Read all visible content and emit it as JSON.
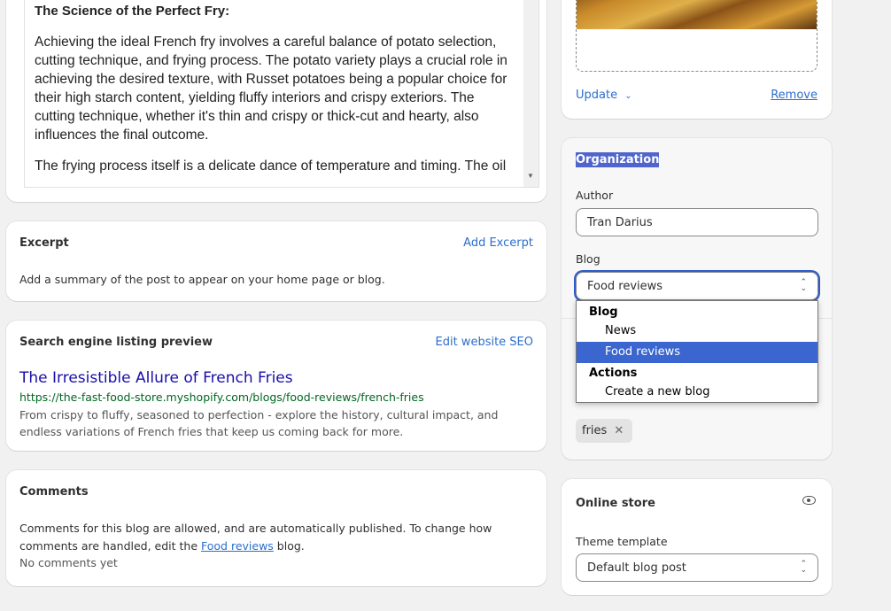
{
  "editor": {
    "heading": "The Science of the Perfect Fry:",
    "paragraphs": [
      "Achieving the ideal French fry involves a careful balance of potato selection, cutting technique, and frying process. The potato variety plays a crucial role in achieving the desired texture, with Russet potatoes being a popular choice for their high starch content, yielding fluffy interiors and crispy exteriors. The cutting technique, whether it's thin and crispy or thick-cut and hearty, also influences the final outcome.",
      "The frying process itself is a delicate dance of temperature and timing. The oil"
    ]
  },
  "excerpt": {
    "title": "Excerpt",
    "action": "Add Excerpt",
    "description": "Add a summary of the post to appear on your home page or blog."
  },
  "seo": {
    "title": "Search engine listing preview",
    "action": "Edit website SEO",
    "page_title": "The Irresistible Allure of French Fries",
    "url": "https://the-fast-food-store.myshopify.com/blogs/food-reviews/french-fries",
    "description": "From crispy to fluffy, seasoned to perfection - explore the history, cultural impact, and endless variations of French fries that keep us coming back for more."
  },
  "comments": {
    "title": "Comments",
    "text_before": "Comments for this blog are allowed, and are automatically published. To change how comments are handled, edit the ",
    "blog_link": "Food reviews",
    "text_after": " blog.",
    "status": "No comments yet"
  },
  "image": {
    "update": "Update",
    "remove": "Remove"
  },
  "organization": {
    "title": "Organization",
    "author_label": "Author",
    "author_value": "Tran Darius",
    "blog_label": "Blog",
    "blog_value": "Food reviews",
    "menu": {
      "group1": "Blog",
      "options1": [
        "News",
        "Food reviews"
      ],
      "group2": "Actions",
      "options2": [
        "Create a new blog"
      ],
      "selected": "Food reviews"
    },
    "tags": [
      "fries"
    ]
  },
  "online_store": {
    "title": "Online store",
    "theme_label": "Theme template",
    "theme_value": "Default blog post"
  },
  "colors": {
    "accent": "#2c6ecb",
    "menu_highlight": "#3b66cf",
    "seo_title": "#1a0dab",
    "seo_url": "#006621"
  }
}
